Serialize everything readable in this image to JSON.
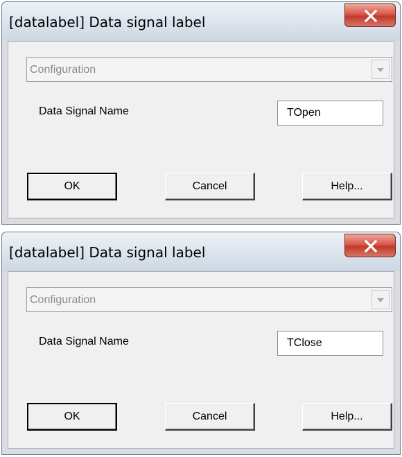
{
  "dialogs": [
    {
      "title": "[datalabel] Data signal label",
      "configuration": {
        "selected": "Configuration"
      },
      "field": {
        "label": "Data Signal Name",
        "value": "TOpen"
      },
      "buttons": {
        "ok": "OK",
        "cancel": "Cancel",
        "help": "Help..."
      }
    },
    {
      "title": "[datalabel] Data signal label",
      "configuration": {
        "selected": "Configuration"
      },
      "field": {
        "label": "Data Signal Name",
        "value": "TClose"
      },
      "buttons": {
        "ok": "OK",
        "cancel": "Cancel",
        "help": "Help..."
      }
    }
  ],
  "icons": {
    "close": "close-icon",
    "dropdown": "chevron-down-icon"
  },
  "colors": {
    "close_button": "#c94a3b",
    "dialog_face": "#f0f0f0",
    "titlebar": "#dfe6ef"
  }
}
